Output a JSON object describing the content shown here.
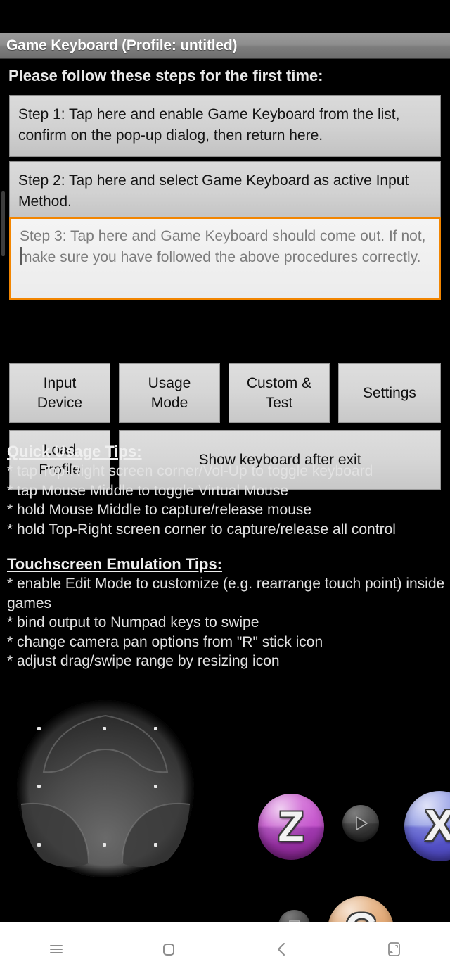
{
  "title_bar": {
    "title": "Game Keyboard (Profile: untitled)"
  },
  "main": {
    "heading": "Please follow these steps for the first time:",
    "steps": [
      {
        "name": "step-1",
        "text": "Step 1: Tap here and enable Game Keyboard from the list, confirm on the pop-up dialog, then return here."
      },
      {
        "name": "step-2",
        "text": "Step 2: Tap here and select Game Keyboard as active Input Method."
      }
    ],
    "step3_field": {
      "placeholder": "Step 3: Tap here and Game Keyboard should come out. If not, make sure you have followed the above procedures correctly.",
      "value": "",
      "focus_color": "#f28500"
    }
  },
  "buttons": [
    {
      "name": "input-device",
      "label": "Input\nDevice"
    },
    {
      "name": "usage-mode",
      "label": "Usage\nMode"
    },
    {
      "name": "custom-test",
      "label": "Custom &\nTest"
    },
    {
      "name": "settings",
      "label": "Settings"
    },
    {
      "name": "load-profile",
      "label": "Load\nProfile"
    },
    {
      "name": "show-keyboard",
      "label": "Show keyboard after exit"
    }
  ],
  "tips": {
    "quick": {
      "title": "Quick Usage Tips:",
      "lines": [
        "* tap Top-Right screen corner/Vol-Up to toggle keyboard",
        "* tap Mouse Middle to toggle Virtual Mouse",
        "* hold Mouse Middle to capture/release mouse",
        "* hold Top-Right screen corner to capture/release all control"
      ]
    },
    "touchscreen": {
      "title": "Touchscreen Emulation Tips:",
      "lines": [
        "* enable Edit Mode to customize (e.g. rearrange touch point) inside games",
        "* bind output to Numpad keys to swipe",
        "* change camera pan options from \"R\" stick icon",
        "* adjust drag/swipe range by resizing icon"
      ]
    }
  },
  "overlay": {
    "dpad": {
      "name": "dpad-control",
      "handles": 8
    },
    "pad_buttons": [
      {
        "name": "z-button",
        "glyph": "Z",
        "color": "#c455cc"
      },
      {
        "name": "x-button",
        "glyph": "X",
        "color": "#8590e0"
      },
      {
        "name": "c-button",
        "glyph": "C",
        "color": "#dda26d"
      },
      {
        "name": "play-button",
        "glyph": "play-icon",
        "color": "#484848"
      },
      {
        "name": "stop-button",
        "glyph": "stop-icon",
        "color": "#484848"
      }
    ]
  },
  "navbar": {
    "items": [
      {
        "name": "recents-button",
        "icon": "hamburger-icon"
      },
      {
        "name": "home-button",
        "icon": "rounded-square-icon"
      },
      {
        "name": "back-button",
        "icon": "chevron-left-icon"
      },
      {
        "name": "multiwindow-button",
        "icon": "resize-corners-icon"
      }
    ]
  }
}
